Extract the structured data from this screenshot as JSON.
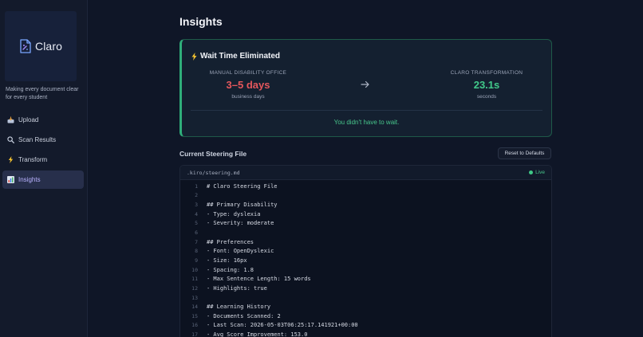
{
  "app": {
    "name": "Claro",
    "tagline": "Making every document clear for every student"
  },
  "nav": [
    {
      "label": "Upload",
      "icon": "inbox-tray-icon",
      "active": false
    },
    {
      "label": "Scan Results",
      "icon": "magnifier-icon",
      "active": false
    },
    {
      "label": "Transform",
      "icon": "lightning-icon",
      "active": false
    },
    {
      "label": "Insights",
      "icon": "bar-chart-icon",
      "active": true
    }
  ],
  "page": {
    "title": "Insights"
  },
  "wait_card": {
    "title": "Wait Time Eliminated",
    "left": {
      "label": "MANUAL DISABILITY OFFICE",
      "value": "3–5 days",
      "sub": "business days"
    },
    "right": {
      "label": "CLARO TRANSFORMATION",
      "value": "23.1s",
      "sub": "seconds"
    },
    "tagline": "You didn't have to wait.",
    "colors": {
      "accent": "#2fae7a",
      "bad": "#e5575c",
      "good": "#41c98a"
    }
  },
  "steering": {
    "section_title": "Current Steering File",
    "reset_label": "Reset to Defaults",
    "file_path": ".kiro/steering.md",
    "status": "Live",
    "lines": [
      {
        "n": "1",
        "text": "# Claro Steering File"
      },
      {
        "n": "2",
        "text": ""
      },
      {
        "n": "3",
        "text": "## Primary Disability"
      },
      {
        "n": "4",
        "text": "- Type: dyslexia"
      },
      {
        "n": "5",
        "text": "- Severity: moderate"
      },
      {
        "n": "6",
        "text": ""
      },
      {
        "n": "7",
        "text": "## Preferences"
      },
      {
        "n": "8",
        "text": "- Font: OpenDyslexic"
      },
      {
        "n": "9",
        "text": "- Size: 16px"
      },
      {
        "n": "10",
        "text": "- Spacing: 1.8"
      },
      {
        "n": "11",
        "text": "- Max Sentence Length: 15 words"
      },
      {
        "n": "12",
        "text": "- Highlights: true"
      },
      {
        "n": "13",
        "text": ""
      },
      {
        "n": "14",
        "text": "## Learning History"
      },
      {
        "n": "15",
        "text": "- Documents Scanned: 2"
      },
      {
        "n": "16",
        "text": "- Last Scan: 2026-05-03T06:25:17.141921+00:00"
      },
      {
        "n": "17",
        "text": "- Avg Score Improvement: 153.0"
      }
    ]
  }
}
